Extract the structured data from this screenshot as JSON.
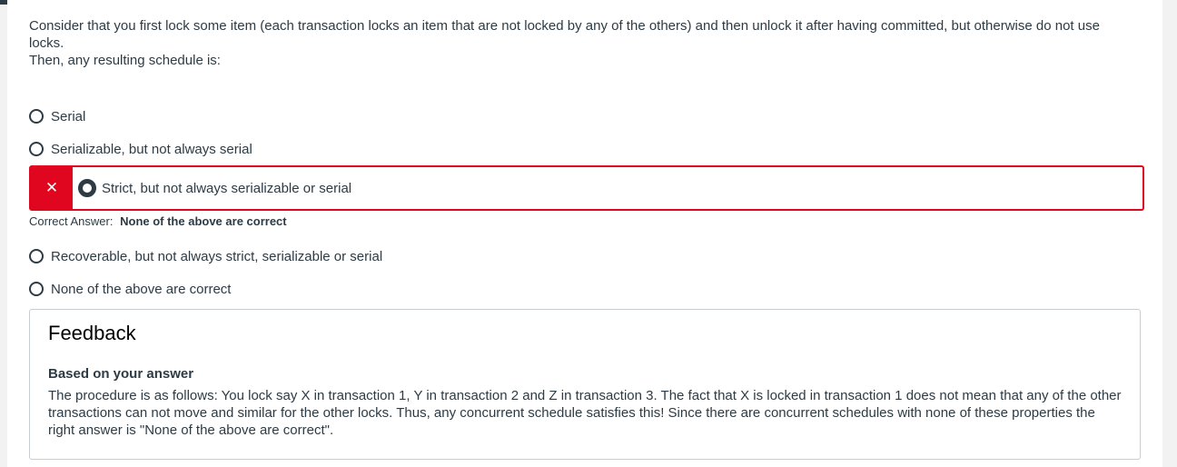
{
  "question": {
    "line1": "Consider that you first lock some item (each transaction locks an item that are not locked by any of the others) and then unlock it after having committed, but otherwise do not use locks.",
    "line2": "Then, any resulting schedule is:"
  },
  "options": [
    {
      "label": "Serial",
      "selected": false
    },
    {
      "label": "Serializable, but not always serial",
      "selected": false
    },
    {
      "label": "Strict, but not always serializable or serial",
      "selected": true
    },
    {
      "label": "Recoverable, but not always strict, serializable or serial",
      "selected": false
    },
    {
      "label": "None of the above are correct",
      "selected": false
    }
  ],
  "wrong_mark": "✕",
  "correct_answer": {
    "label": "Correct Answer:",
    "value": "None of the above are correct"
  },
  "feedback": {
    "title": "Feedback",
    "subtitle": "Based on your answer",
    "text": "The procedure is as follows: You lock say X in transaction 1, Y in transaction 2 and Z in transaction 3. The fact that X is locked in transaction 1 does not mean that any of the other transactions can not move and similar for the other locks. Thus, any concurrent schedule satisfies this! Since there are concurrent schedules with none of these properties the right answer is \"None of the above are correct\"."
  },
  "colors": {
    "wrong": "#e0061f",
    "text": "#2d3b45",
    "border": "#c7cdd1"
  }
}
